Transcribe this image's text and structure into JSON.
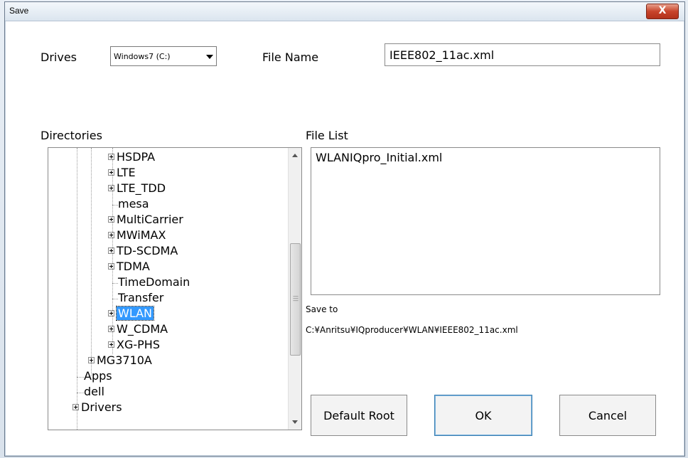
{
  "window": {
    "title": "Save",
    "close_glyph": "X"
  },
  "drives": {
    "label": "Drives",
    "selected": "Windows7 (C:)"
  },
  "file_name": {
    "label": "File Name",
    "value": "IEEE802_11ac.xml"
  },
  "directories": {
    "label": "Directories",
    "items": [
      {
        "label": "HSDPA",
        "expandable": true
      },
      {
        "label": "LTE",
        "expandable": true
      },
      {
        "label": "LTE_TDD",
        "expandable": true
      },
      {
        "label": "mesa",
        "expandable": false
      },
      {
        "label": "MultiCarrier",
        "expandable": true
      },
      {
        "label": "MWiMAX",
        "expandable": true
      },
      {
        "label": "TD-SCDMA",
        "expandable": true
      },
      {
        "label": "TDMA",
        "expandable": true
      },
      {
        "label": "TimeDomain",
        "expandable": false
      },
      {
        "label": "Transfer",
        "expandable": false
      },
      {
        "label": "WLAN",
        "expandable": true,
        "selected": true
      },
      {
        "label": "W_CDMA",
        "expandable": true
      },
      {
        "label": "XG-PHS",
        "expandable": true
      },
      {
        "label": "MG3710A",
        "expandable": true
      },
      {
        "label": "Apps",
        "expandable": false
      },
      {
        "label": "dell",
        "expandable": false
      },
      {
        "label": "Drivers",
        "expandable": true
      }
    ]
  },
  "file_list": {
    "label": "File List",
    "items": [
      "WLANIQpro_Initial.xml"
    ]
  },
  "save_to": {
    "label": "Save to",
    "path": "C:¥Anritsu¥IQproducer¥WLAN¥IEEE802_11ac.xml"
  },
  "buttons": {
    "default_root": "Default Root",
    "ok": "OK",
    "cancel": "Cancel"
  },
  "colors": {
    "selection": "#3399ff",
    "close_button": "#c8452b"
  }
}
